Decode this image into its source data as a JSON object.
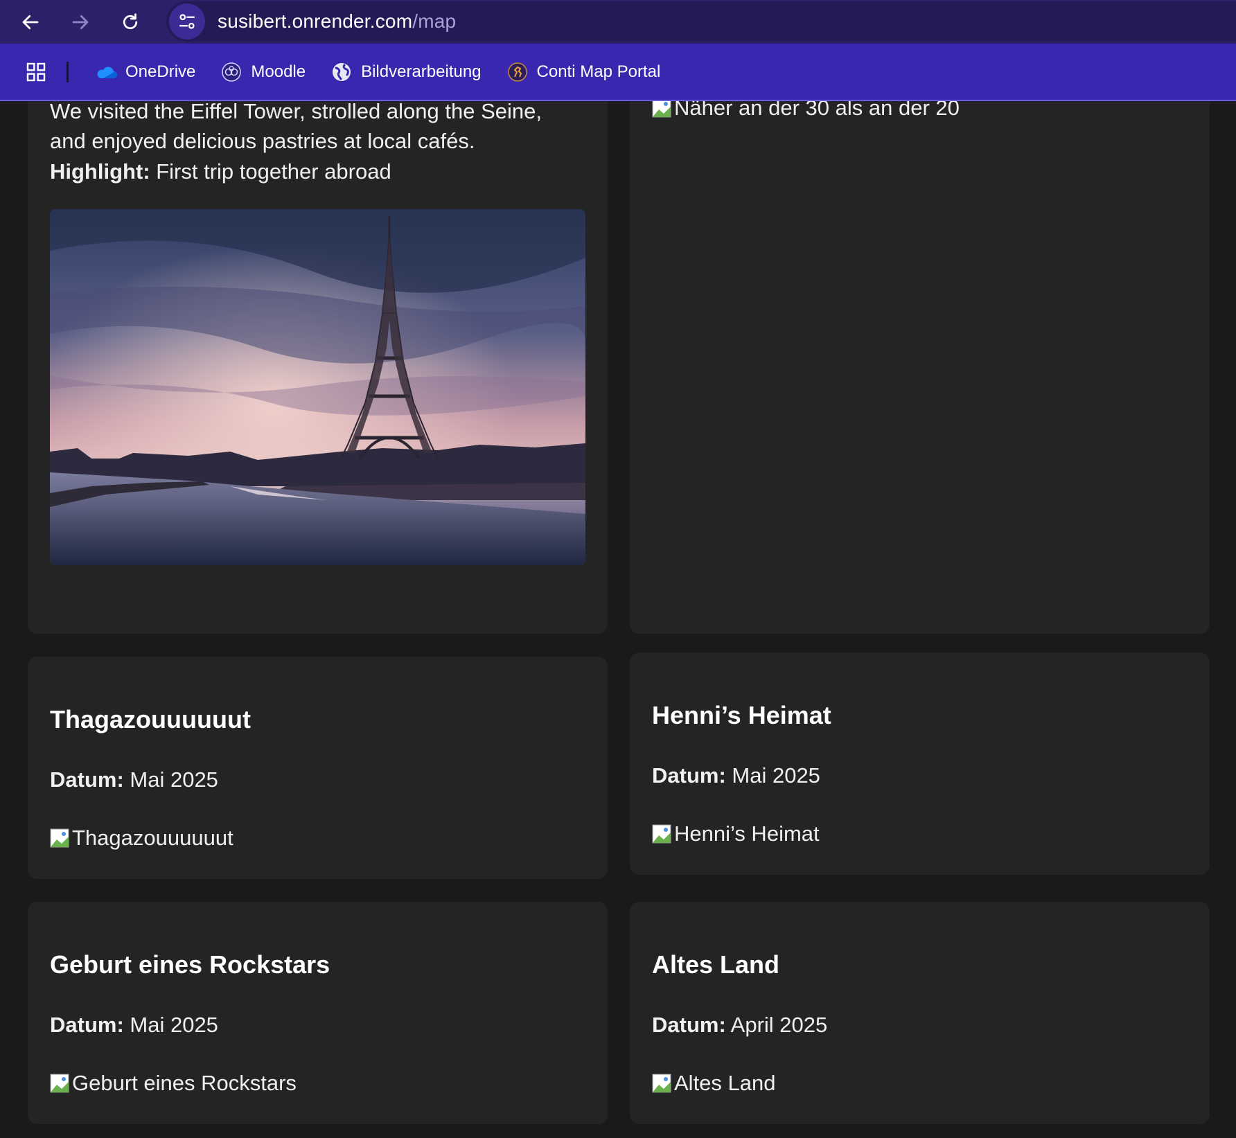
{
  "browser": {
    "url_host": "susibert.onrender.com",
    "url_path": "/map",
    "bookmarks": [
      {
        "label": "OneDrive",
        "icon": "onedrive-cloud-icon"
      },
      {
        "label": "Moodle",
        "icon": "moodle-icon"
      },
      {
        "label": "Bildverarbeitung",
        "icon": "globe-icon"
      },
      {
        "label": "Conti Map Portal",
        "icon": "conti-horse-icon"
      }
    ]
  },
  "colors": {
    "titlebar": "#2c2169",
    "bookmarks_bar": "#3927b0",
    "page_bg": "#1a1a1a",
    "card_bg": "#242424"
  },
  "cards": {
    "paris": {
      "description_line1": "We visited the Eiffel Tower, strolled along the Seine,",
      "description_line2": "and enjoyed delicious pastries at local cafés.",
      "highlight_label": "Highlight:",
      "highlight_text": " First trip together abroad",
      "image": "eiffel-tower-photo"
    },
    "top_right": {
      "image_alt": "Näher an der 30 als an der 20"
    },
    "thagazout": {
      "title": "Thagazouuuuuut",
      "date_label": "Datum:",
      "date_value": " Mai 2025",
      "image_alt": "Thagazouuuuuut"
    },
    "henni": {
      "title": "Henni’s Heimat",
      "date_label": "Datum:",
      "date_value": " Mai 2025",
      "image_alt": "Henni’s Heimat"
    },
    "rockstar": {
      "title": "Geburt eines Rockstars",
      "date_label": "Datum:",
      "date_value": " Mai 2025",
      "image_alt": "Geburt eines Rockstars"
    },
    "altes_land": {
      "title": "Altes Land",
      "date_label": "Datum:",
      "date_value": " April 2025",
      "image_alt": "Altes Land"
    }
  }
}
